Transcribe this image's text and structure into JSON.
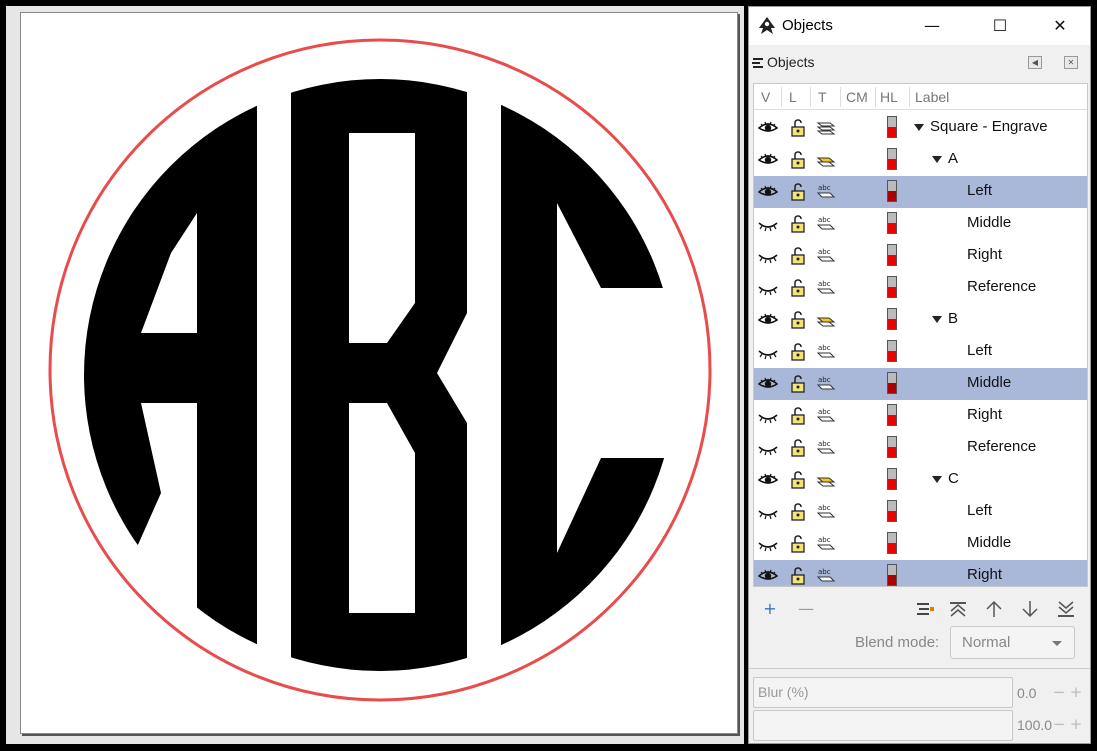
{
  "canvas": {
    "monogram_letters": "ABC"
  },
  "window": {
    "title": "Objects",
    "minimize": "—",
    "maximize": "☐",
    "close": "✕"
  },
  "dock": {
    "title": "Objects"
  },
  "columns": {
    "v": "V",
    "l": "L",
    "t": "T",
    "cm": "CM",
    "hl": "HL",
    "label": "Label"
  },
  "rows": [
    {
      "label": "Square - Engrave",
      "level": 0,
      "expander": true,
      "visible": true,
      "type": "group",
      "selected": false
    },
    {
      "label": "A",
      "level": 1,
      "expander": true,
      "visible": true,
      "type": "layer",
      "selected": false
    },
    {
      "label": "Left",
      "level": 2,
      "expander": false,
      "visible": true,
      "type": "text",
      "selected": true
    },
    {
      "label": "Middle",
      "level": 2,
      "expander": false,
      "visible": false,
      "type": "text",
      "selected": false
    },
    {
      "label": "Right",
      "level": 2,
      "expander": false,
      "visible": false,
      "type": "text",
      "selected": false
    },
    {
      "label": "Reference",
      "level": 2,
      "expander": false,
      "visible": false,
      "type": "text",
      "selected": false
    },
    {
      "label": "B",
      "level": 1,
      "expander": true,
      "visible": true,
      "type": "layer",
      "selected": false
    },
    {
      "label": "Left",
      "level": 2,
      "expander": false,
      "visible": false,
      "type": "text",
      "selected": false
    },
    {
      "label": "Middle",
      "level": 2,
      "expander": false,
      "visible": true,
      "type": "text",
      "selected": true
    },
    {
      "label": "Right",
      "level": 2,
      "expander": false,
      "visible": false,
      "type": "text",
      "selected": false
    },
    {
      "label": "Reference",
      "level": 2,
      "expander": false,
      "visible": false,
      "type": "text",
      "selected": false
    },
    {
      "label": "C",
      "level": 1,
      "expander": true,
      "visible": true,
      "type": "layer",
      "selected": false
    },
    {
      "label": "Left",
      "level": 2,
      "expander": false,
      "visible": false,
      "type": "text",
      "selected": false
    },
    {
      "label": "Middle",
      "level": 2,
      "expander": false,
      "visible": false,
      "type": "text",
      "selected": false
    },
    {
      "label": "Right",
      "level": 2,
      "expander": false,
      "visible": true,
      "type": "text",
      "selected": true
    }
  ],
  "toolbar": {
    "add": "+",
    "remove": "—"
  },
  "blend": {
    "label": "Blend mode:",
    "value": "Normal"
  },
  "blur": {
    "label": "Blur (%)",
    "value": "0.0"
  },
  "opacity": {
    "value": "100.0"
  },
  "colors": {
    "selection": "#a9b7d9",
    "circle_outline": "#e84c4c",
    "highlight": "#e00000"
  }
}
